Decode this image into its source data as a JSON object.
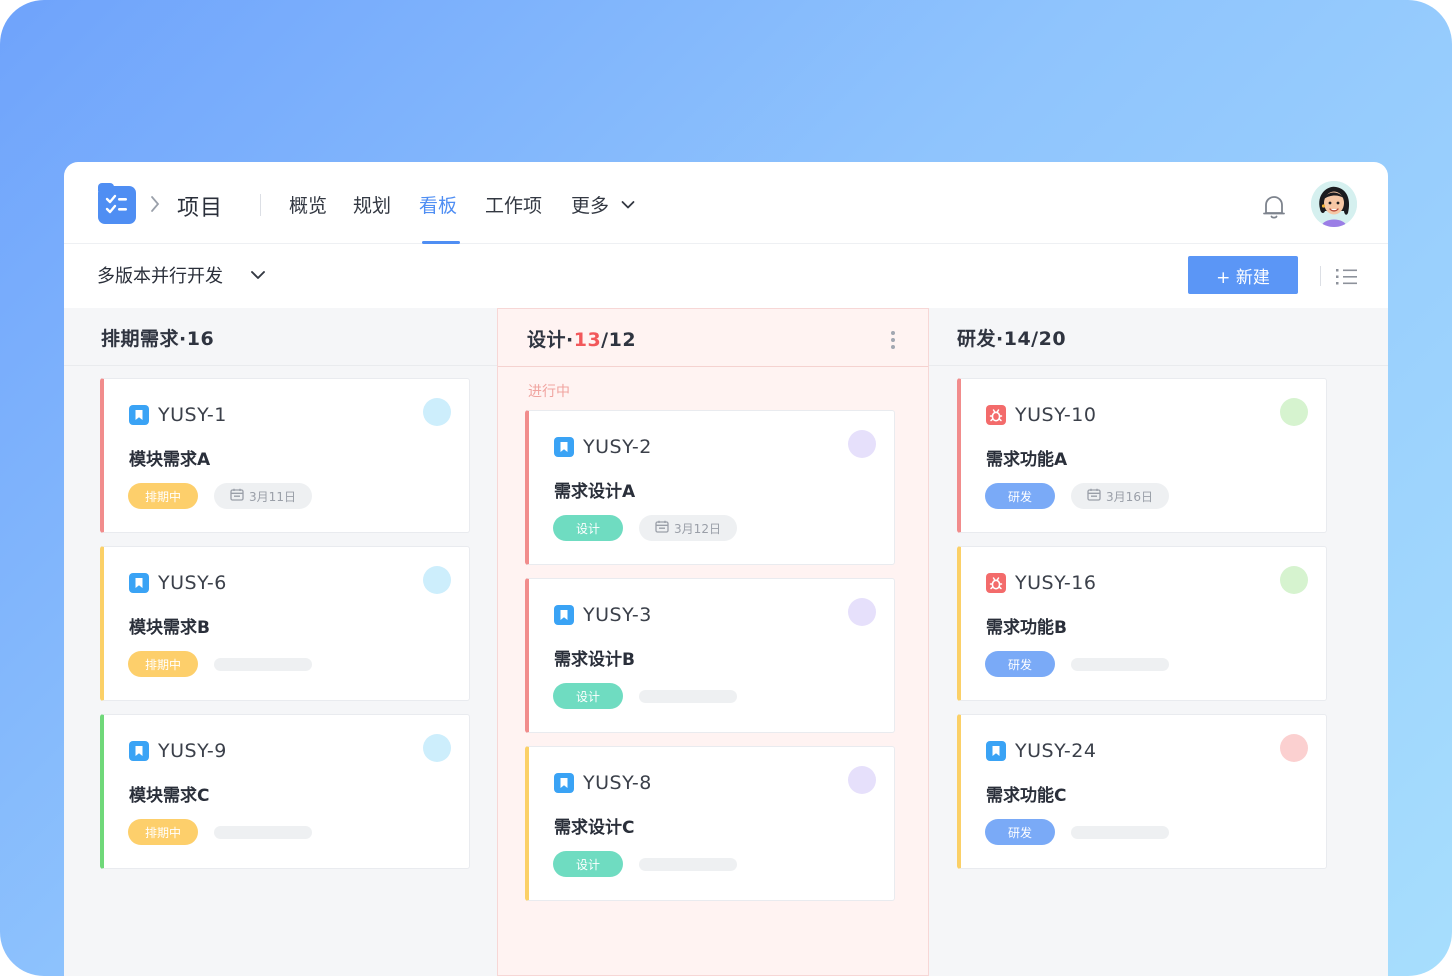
{
  "app": {
    "breadcrumb_title": "项目",
    "nav_tabs": [
      {
        "label": "概览"
      },
      {
        "label": "规划"
      },
      {
        "label": "看板",
        "active": true
      },
      {
        "label": "工作项"
      },
      {
        "label": "更多"
      }
    ]
  },
  "toolbar": {
    "project_name": "多版本并行开发",
    "new_button_label": "+ 新建"
  },
  "colors": {
    "accent": "#4f8ef3",
    "tag_schedule": "#fdcf6b",
    "tag_design": "#6fdcc1",
    "tag_dev": "#7aaaf7",
    "border_red": "#f18c8c",
    "border_yellow": "#fbd067",
    "border_green": "#6fd879"
  },
  "columns": [
    {
      "title": "排期需求·16",
      "cards": [
        {
          "id": "YUSY-1",
          "title": "模块需求A",
          "tag": "排期中",
          "date": "3月11日",
          "type": "story"
        },
        {
          "id": "YUSY-6",
          "title": "模块需求B",
          "tag": "排期中",
          "date": "",
          "type": "story"
        },
        {
          "id": "YUSY-9",
          "title": "模块需求C",
          "tag": "排期中",
          "date": "",
          "type": "story"
        }
      ]
    },
    {
      "title_prefix": "设计·",
      "title_count": "13",
      "title_limit": "/12",
      "sub_label": "进行中",
      "cards": [
        {
          "id": "YUSY-2",
          "title": "需求设计A",
          "tag": "设计",
          "date": "3月12日",
          "type": "story"
        },
        {
          "id": "YUSY-3",
          "title": "需求设计B",
          "tag": "设计",
          "date": "",
          "type": "story"
        },
        {
          "id": "YUSY-8",
          "title": "需求设计C",
          "tag": "设计",
          "date": "",
          "type": "story"
        }
      ]
    },
    {
      "title": "研发·14/20",
      "cards": [
        {
          "id": "YUSY-10",
          "title": "需求功能A",
          "tag": "研发",
          "date": "3月16日",
          "type": "bug"
        },
        {
          "id": "YUSY-16",
          "title": "需求功能B",
          "tag": "研发",
          "date": "",
          "type": "bug"
        },
        {
          "id": "YUSY-24",
          "title": "需求功能C",
          "tag": "研发",
          "date": "",
          "type": "story"
        }
      ]
    }
  ]
}
